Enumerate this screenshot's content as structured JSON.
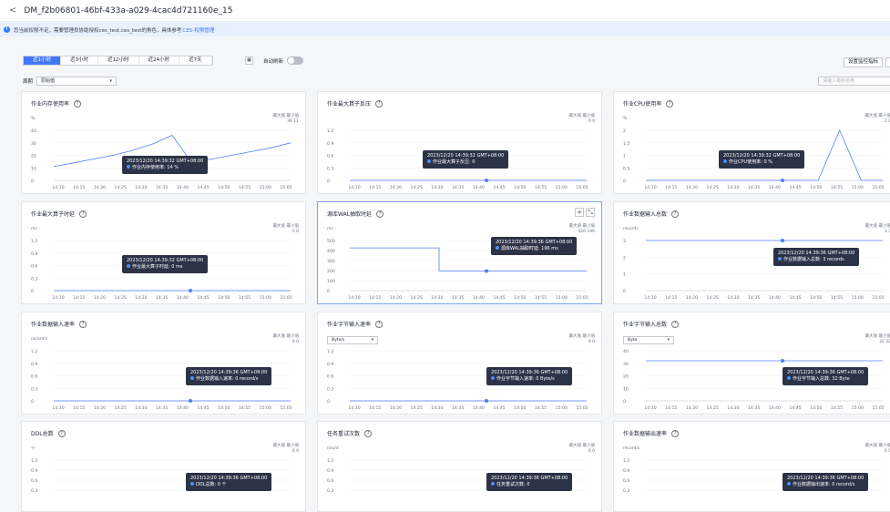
{
  "header": {
    "back_icon": "chevron-left-icon",
    "title": "DM_f2b06801-46bf-433a-a029-4cac4d721160e_15"
  },
  "notice": {
    "text": "您当前权限不足，需要管理员协助授权ces_test,ces_test的角色，具体参考",
    "link": "CES-权限管理"
  },
  "toolbar": {
    "tabs": [
      "近1小时",
      "近3小时",
      "近12小时",
      "近24小时",
      "近7天"
    ],
    "active_tab": 0,
    "auto_refresh_label": "自动刷新",
    "auto_refresh": false,
    "settings_button": "设置监控指标",
    "period_label": "周期",
    "period_value": "原始值",
    "search_placeholder": "请输入指标名称"
  },
  "x_ticks": [
    "14:10",
    "14:15",
    "14:20",
    "14:25",
    "14:30",
    "14:35",
    "14:40",
    "14:45",
    "14:50",
    "14:55",
    "15:00",
    "15:05"
  ],
  "max_label": "最大值",
  "min_label": "最小值",
  "cards": [
    {
      "title": "作业内存使用率",
      "unit": "%",
      "max": "36",
      "min": "11",
      "yticks": [
        "40",
        "30",
        "20",
        "10",
        "0"
      ],
      "tip_time": "2023/12/20 14:39:32 GMT+08:00",
      "tip_value": "作业内存使用率: 14 %"
    },
    {
      "title": "作业最大算子反压",
      "unit": "",
      "max": "0",
      "min": "0",
      "yticks": [
        "1.2",
        "0.9",
        "0.6",
        "0.3",
        "0"
      ],
      "tip_time": "2023/12/20 14:39:32 GMT+08:00",
      "tip_value": "作业最大算子反压: 0"
    },
    {
      "title": "作业CPU使用率",
      "unit": "%",
      "max": "2",
      "min": "0",
      "yticks": [
        "2",
        "1.5",
        "1",
        "0.5",
        "0"
      ],
      "tip_time": "2023/12/20 14:39:32 GMT+08:00",
      "tip_value": "作业CPU使用率: 0 %"
    },
    {
      "title": "作业最大算子时延",
      "unit": "ms",
      "max": "0",
      "min": "0",
      "yticks": [
        "1.2",
        "0.9",
        "0.6",
        "0.3",
        "0"
      ],
      "tip_time": "2023/12/20 14:39:32 GMT+08:00",
      "tip_value": "作业最大算子时延: 0 ms"
    },
    {
      "title": "源库WAL抽取时延",
      "unit": "ms",
      "max": "426",
      "min": "196",
      "yticks": [
        "500",
        "400",
        "300",
        "200",
        "100",
        "0"
      ],
      "tip_time": "2023/12/20 14:39:36 GMT+08:00",
      "tip_value": "源库WAL抽取时延: 196 ms"
    },
    {
      "title": "作业数据输入总数",
      "unit": "records",
      "max": "3",
      "min": "3",
      "yticks": [
        "3",
        "2",
        "1",
        "0"
      ],
      "tip_time": "2023/12/20 14:39:36 GMT+08:00",
      "tip_value": "作业数据输入总数: 3 records"
    },
    {
      "title": "作业数据输入速率",
      "unit": "record/s",
      "max": "0",
      "min": "0",
      "yticks": [
        "1.2",
        "0.9",
        "0.6",
        "0.3",
        "0"
      ],
      "tip_time": "2023/12/20 14:39:36 GMT+08:00",
      "tip_value": "作业数据输入速率: 0 record/s"
    },
    {
      "title": "作业字节输入速率",
      "unit": "",
      "select": "Byte/s",
      "max": "0",
      "min": "0",
      "yticks": [
        "1.2",
        "0.9",
        "0.6",
        "0.3",
        "0"
      ],
      "tip_time": "2023/12/20 14:39:36 GMT+08:00",
      "tip_value": "作业字节输入速率: 0 Byte/s"
    },
    {
      "title": "作业字节输入总数",
      "unit": "",
      "select": "Byte",
      "max": "32",
      "min": "32",
      "yticks": [
        "40",
        "30",
        "20",
        "10",
        "0"
      ],
      "tip_time": "2023/12/20 14:39:36 GMT+08:00",
      "tip_value": "作业字节输入总数: 32 Byte"
    },
    {
      "title": "DDL总数",
      "unit": "个",
      "max": "0",
      "min": "0",
      "yticks": [
        "1.2",
        "0.9",
        "0.6",
        "0.3"
      ],
      "tip_time": "2023/12/20 14:39:36 GMT+08:00",
      "tip_value": "DDL总数: 0 个"
    },
    {
      "title": "任务重试次数",
      "unit": "count",
      "max": "0",
      "min": "0",
      "yticks": [
        "1.2",
        "0.9",
        "0.6",
        "0.3"
      ],
      "tip_time": "2023/12/20 14:39:36 GMT+08:00",
      "tip_value": "任务重试次数: 0"
    },
    {
      "title": "作业数据输出速率",
      "unit": "record/s",
      "max": "0",
      "min": "0",
      "yticks": [
        "1.2",
        "0.9",
        "0.6",
        "0.3"
      ],
      "tip_time": "2023/12/20 14:39:36 GMT+08:00",
      "tip_value": "作业数据输出速率: 0 record/s"
    }
  ],
  "chart_data": [
    {
      "type": "line",
      "title": "作业内存使用率",
      "ylabel": "%",
      "ylim": [
        0,
        40
      ],
      "x": [
        "14:10",
        "14:15",
        "14:20",
        "14:25",
        "14:30",
        "14:35",
        "14:35",
        "14:40",
        "14:45",
        "14:50",
        "14:55",
        "15:00",
        "15:05"
      ],
      "series": [
        {
          "values": [
            11,
            14,
            17,
            20,
            24,
            29,
            36,
            14,
            17,
            20,
            23,
            26,
            30
          ]
        }
      ]
    },
    {
      "type": "line",
      "title": "作业最大算子反压",
      "ylim": [
        0,
        1.2
      ],
      "series": [
        {
          "values": [
            0,
            0,
            0,
            0,
            0,
            0,
            0,
            0,
            0,
            0,
            0,
            0
          ]
        }
      ]
    },
    {
      "type": "line",
      "title": "作业CPU使用率",
      "ylabel": "%",
      "ylim": [
        0,
        2
      ],
      "series": [
        {
          "values": [
            0,
            0,
            0,
            0,
            0,
            0,
            0,
            0,
            0,
            2,
            0,
            0
          ]
        }
      ]
    },
    {
      "type": "line",
      "title": "作业最大算子时延",
      "ylabel": "ms",
      "ylim": [
        0,
        1.2
      ],
      "series": [
        {
          "values": [
            0,
            0,
            0,
            0,
            0,
            0,
            0,
            0,
            0,
            0,
            0,
            0
          ]
        }
      ]
    },
    {
      "type": "line",
      "title": "源库WAL抽取时延",
      "ylabel": "ms",
      "ylim": [
        0,
        500
      ],
      "series": [
        {
          "values": [
            426,
            426,
            426,
            426,
            426,
            196,
            196,
            196,
            196,
            196,
            196,
            196
          ]
        }
      ]
    },
    {
      "type": "line",
      "title": "作业数据输入总数",
      "ylabel": "records",
      "ylim": [
        0,
        3
      ],
      "series": [
        {
          "values": [
            3,
            3,
            3,
            3,
            3,
            3,
            3,
            3,
            3,
            3,
            3,
            3
          ]
        }
      ]
    },
    {
      "type": "line",
      "title": "作业数据输入速率",
      "ylabel": "record/s",
      "ylim": [
        0,
        1.2
      ],
      "series": [
        {
          "values": [
            0,
            0,
            0,
            0,
            0,
            0,
            0,
            0,
            0,
            0,
            0,
            0
          ]
        }
      ]
    },
    {
      "type": "line",
      "title": "作业字节输入速率",
      "ylabel": "Byte/s",
      "ylim": [
        0,
        1.2
      ],
      "series": [
        {
          "values": [
            0,
            0,
            0,
            0,
            0,
            0,
            0,
            0,
            0,
            0,
            0,
            0
          ]
        }
      ]
    },
    {
      "type": "line",
      "title": "作业字节输入总数",
      "ylabel": "Byte",
      "ylim": [
        0,
        40
      ],
      "series": [
        {
          "values": [
            32,
            32,
            32,
            32,
            32,
            32,
            32,
            32,
            32,
            32,
            32,
            32
          ]
        }
      ]
    }
  ]
}
